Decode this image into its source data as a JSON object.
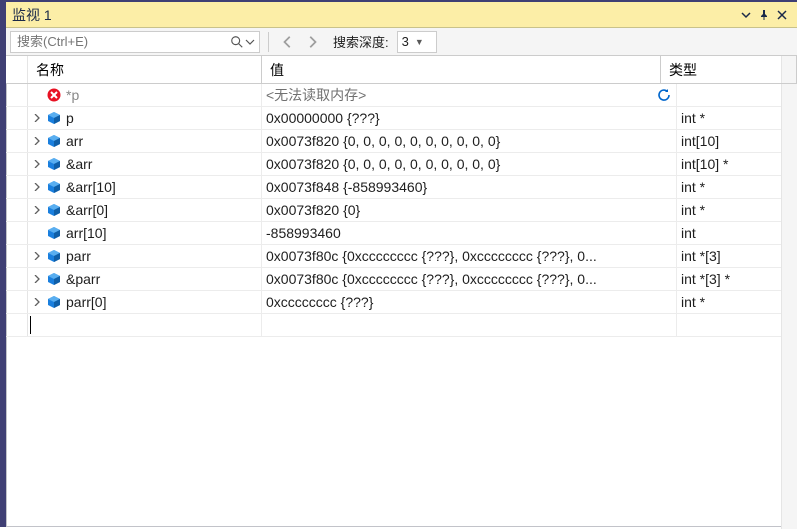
{
  "panel": {
    "title": "监视 1"
  },
  "toolbar": {
    "search_placeholder": "搜索(Ctrl+E)",
    "depth_label": "搜索深度:",
    "depth_value": "3"
  },
  "columns": {
    "name": "名称",
    "value": "值",
    "type": "类型"
  },
  "rows": [
    {
      "expandable": false,
      "icon": "error",
      "name": "*p",
      "name_dim": true,
      "value": "<无法读取内存>",
      "value_muted": true,
      "refresh": true,
      "type": ""
    },
    {
      "expandable": true,
      "icon": "var",
      "name": "p",
      "value": "0x00000000 {???}",
      "type": "int *"
    },
    {
      "expandable": true,
      "icon": "var",
      "name": "arr",
      "value": "0x0073f820 {0, 0, 0, 0, 0, 0, 0, 0, 0, 0}",
      "type": "int[10]"
    },
    {
      "expandable": true,
      "icon": "var",
      "name": "&arr",
      "value": "0x0073f820 {0, 0, 0, 0, 0, 0, 0, 0, 0, 0}",
      "type": "int[10] *"
    },
    {
      "expandable": true,
      "icon": "var",
      "name": "&arr[10]",
      "value": "0x0073f848 {-858993460}",
      "type": "int *"
    },
    {
      "expandable": true,
      "icon": "var",
      "name": "&arr[0]",
      "value": "0x0073f820 {0}",
      "type": "int *"
    },
    {
      "expandable": false,
      "icon": "var",
      "name": "arr[10]",
      "value": "-858993460",
      "type": "int"
    },
    {
      "expandable": true,
      "icon": "var",
      "name": "parr",
      "value": "0x0073f80c {0xcccccccc {???}, 0xcccccccc {???}, 0...",
      "type": "int *[3]"
    },
    {
      "expandable": true,
      "icon": "var",
      "name": "&parr",
      "value": "0x0073f80c {0xcccccccc {???}, 0xcccccccc {???}, 0...",
      "type": "int *[3] *"
    },
    {
      "expandable": true,
      "icon": "var",
      "name": "parr[0]",
      "value": "0xcccccccc {???}",
      "type": "int *"
    }
  ]
}
